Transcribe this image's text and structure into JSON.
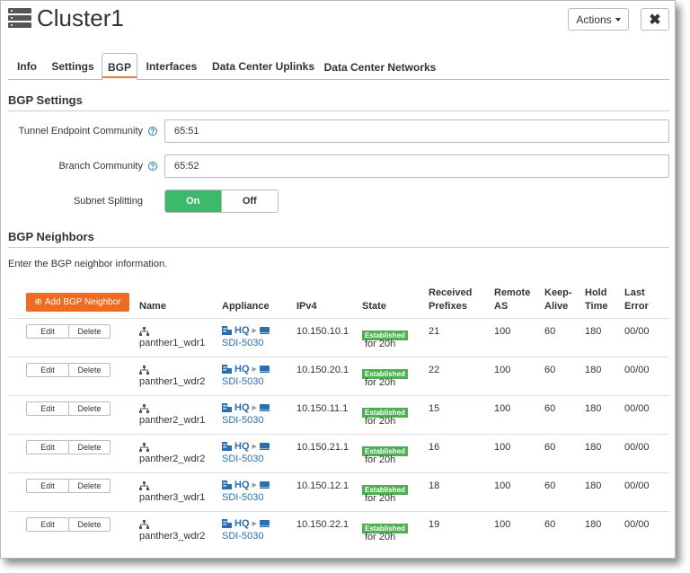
{
  "header": {
    "title": "Cluster1",
    "actions_label": "Actions",
    "close_label": "✖"
  },
  "tabs": [
    {
      "label": "Info",
      "active": false
    },
    {
      "label": "Settings",
      "active": false
    },
    {
      "label": "BGP",
      "active": true
    },
    {
      "label": "Interfaces",
      "active": false
    },
    {
      "label": "Data Center Uplinks",
      "active": false
    },
    {
      "label": "Data Center Networks",
      "active": false
    }
  ],
  "bgp_settings": {
    "heading": "BGP Settings",
    "tunnel_label": "Tunnel Endpoint Community",
    "tunnel_value": "65:51",
    "branch_label": "Branch Community",
    "branch_value": "65:52",
    "subnet_label": "Subnet Splitting",
    "toggle_on": "On",
    "toggle_off": "Off"
  },
  "neighbors": {
    "heading": "BGP Neighbors",
    "description": "Enter the BGP neighbor information.",
    "add_button": "Add BGP Neighbor",
    "columns": [
      "Name",
      "Appliance",
      "IPv4",
      "State",
      "Received Prefixes",
      "Remote AS",
      "Keep-Alive",
      "Hold Time",
      "Last Error"
    ],
    "edit_label": "Edit",
    "delete_label": "Delete",
    "rows": [
      {
        "name": "panther1_wdr1",
        "site": "HQ",
        "appliance": "SDI-5030",
        "ipv4": "10.150.10.1",
        "state": "Established",
        "uptime": "for 20h",
        "prefixes": "21",
        "remote_as": "100",
        "keepalive": "60",
        "hold": "180",
        "last_error": "00/00"
      },
      {
        "name": "panther1_wdr2",
        "site": "HQ",
        "appliance": "SDI-5030",
        "ipv4": "10.150.20.1",
        "state": "Established",
        "uptime": "for 20h",
        "prefixes": "22",
        "remote_as": "100",
        "keepalive": "60",
        "hold": "180",
        "last_error": "00/00"
      },
      {
        "name": "panther2_wdr1",
        "site": "HQ",
        "appliance": "SDI-5030",
        "ipv4": "10.150.11.1",
        "state": "Established",
        "uptime": "for 20h",
        "prefixes": "15",
        "remote_as": "100",
        "keepalive": "60",
        "hold": "180",
        "last_error": "00/00"
      },
      {
        "name": "panther2_wdr2",
        "site": "HQ",
        "appliance": "SDI-5030",
        "ipv4": "10.150.21.1",
        "state": "Established",
        "uptime": "for 20h",
        "prefixes": "16",
        "remote_as": "100",
        "keepalive": "60",
        "hold": "180",
        "last_error": "00/00"
      },
      {
        "name": "panther3_wdr1",
        "site": "HQ",
        "appliance": "SDI-5030",
        "ipv4": "10.150.12.1",
        "state": "Established",
        "uptime": "for 20h",
        "prefixes": "18",
        "remote_as": "100",
        "keepalive": "60",
        "hold": "180",
        "last_error": "00/00"
      },
      {
        "name": "panther3_wdr2",
        "site": "HQ",
        "appliance": "SDI-5030",
        "ipv4": "10.150.22.1",
        "state": "Established",
        "uptime": "for 20h",
        "prefixes": "19",
        "remote_as": "100",
        "keepalive": "60",
        "hold": "180",
        "last_error": "00/00"
      }
    ]
  },
  "colors": {
    "accent": "#ef6b22",
    "toggle_on": "#3cb96a",
    "badge": "#4caf50",
    "link": "#2a6fb0"
  }
}
